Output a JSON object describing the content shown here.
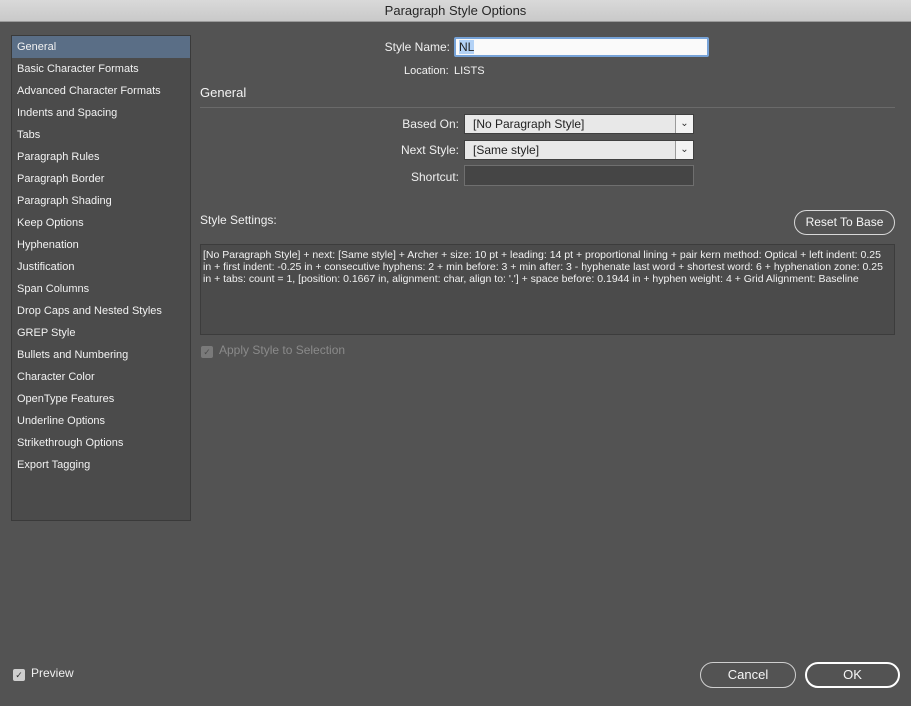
{
  "window": {
    "title": "Paragraph Style Options"
  },
  "sidebar": {
    "items": [
      {
        "label": "General",
        "selected": true
      },
      {
        "label": "Basic Character Formats"
      },
      {
        "label": "Advanced Character Formats"
      },
      {
        "label": "Indents and Spacing"
      },
      {
        "label": "Tabs"
      },
      {
        "label": "Paragraph Rules"
      },
      {
        "label": "Paragraph Border"
      },
      {
        "label": "Paragraph Shading"
      },
      {
        "label": "Keep Options"
      },
      {
        "label": "Hyphenation"
      },
      {
        "label": "Justification"
      },
      {
        "label": "Span Columns"
      },
      {
        "label": "Drop Caps and Nested Styles"
      },
      {
        "label": "GREP Style"
      },
      {
        "label": "Bullets and Numbering"
      },
      {
        "label": "Character Color"
      },
      {
        "label": "OpenType Features"
      },
      {
        "label": "Underline Options"
      },
      {
        "label": "Strikethrough Options"
      },
      {
        "label": "Export Tagging"
      }
    ]
  },
  "form": {
    "style_name_label": "Style Name:",
    "style_name_value": "NL",
    "location_label": "Location:",
    "location_value": "LISTS",
    "section_title": "General",
    "based_on_label": "Based On:",
    "based_on_value": "[No Paragraph Style]",
    "next_style_label": "Next Style:",
    "next_style_value": "[Same style]",
    "shortcut_label": "Shortcut:",
    "shortcut_value": "",
    "style_settings_label": "Style Settings:",
    "reset_label": "Reset To Base",
    "style_settings_text": "[No Paragraph Style] + next: [Same style] + Archer + size: 10 pt + leading: 14 pt + proportional lining + pair kern method: Optical + left indent: 0.25 in + first indent: -0.25 in + consecutive hyphens: 2 + min before: 3 + min after: 3 - hyphenate last word + shortest word: 6 + hyphenation zone:  0.25 in + tabs: count = 1, [position: 0.1667 in, alignment: char, align to: '.']  + space before: 0.1944 in + hyphen weight: 4 + Grid Alignment:  Baseline",
    "apply_label": "Apply Style to Selection",
    "apply_checked": true,
    "apply_disabled": true
  },
  "footer": {
    "preview_label": "Preview",
    "preview_checked": true,
    "cancel_label": "Cancel",
    "ok_label": "OK"
  },
  "icons": {
    "dropdown": "chevron-down-icon",
    "check": "checkmark-icon"
  },
  "colors": {
    "background": "#535353",
    "selection": "#5a6e86",
    "focus_ring": "#77a3d8"
  }
}
